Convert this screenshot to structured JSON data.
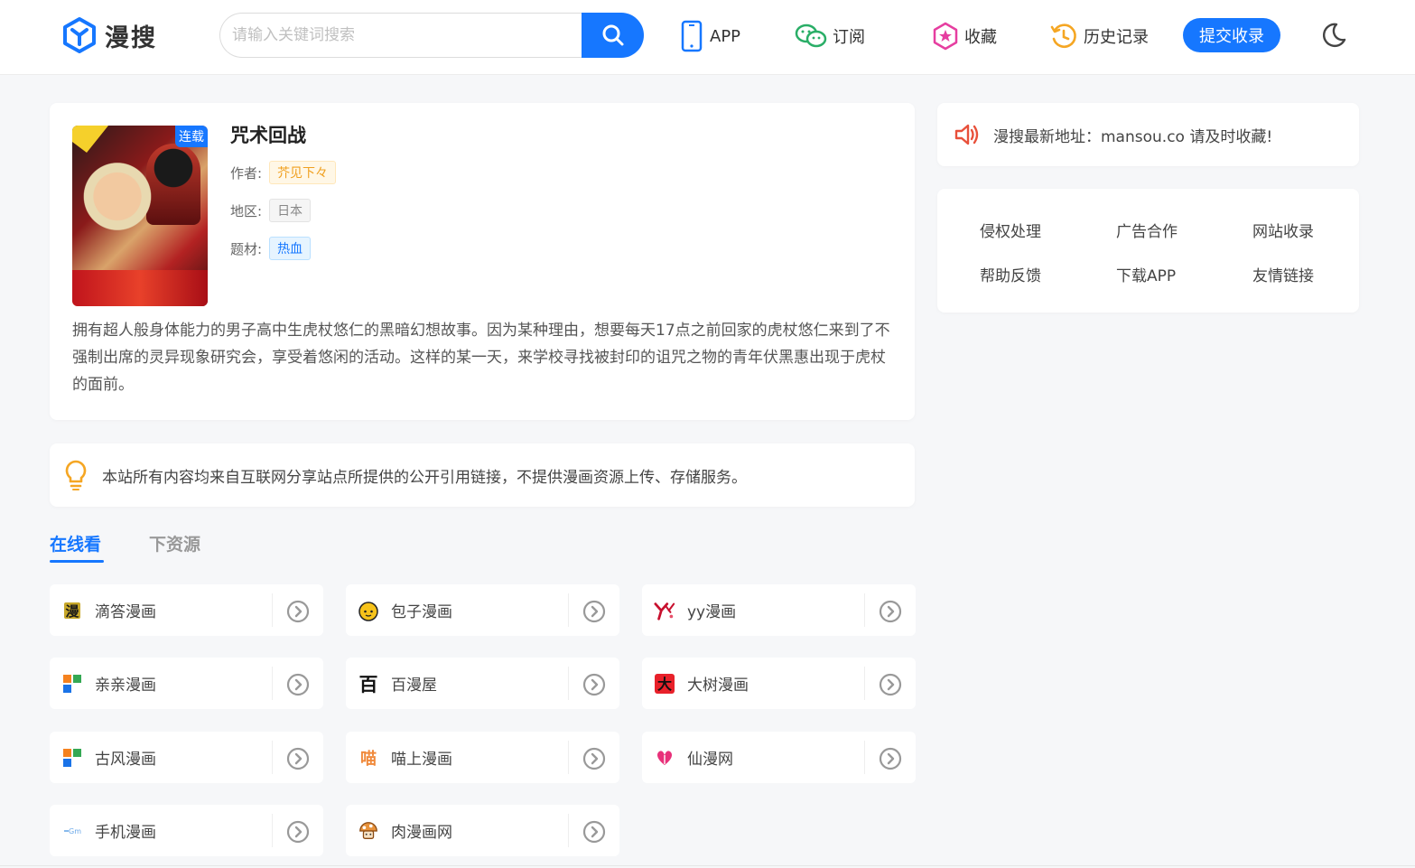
{
  "header": {
    "logo_text": "漫搜",
    "search_placeholder": "请输入关键词搜索",
    "nav": {
      "app": "APP",
      "subscribe": "订阅",
      "favorites": "收藏",
      "history": "历史记录"
    },
    "submit_label": "提交收录",
    "brand_color": "#1677ff"
  },
  "comic": {
    "badge": "连载",
    "title": "咒术回战",
    "author_label": "作者:",
    "author": "芥见下々",
    "region_label": "地区:",
    "region": "日本",
    "genre_label": "题材:",
    "genre": "热血",
    "description": "拥有超人般身体能力的男子高中生虎杖悠仁的黑暗幻想故事。因为某种理由，想要每天17点之前回家的虎杖悠仁来到了不强制出席的灵异现象研究会，享受着悠闲的活动。这样的某一天，来学校寻找被封印的诅咒之物的青年伏黑惠出现于虎杖的面前。"
  },
  "notice": "本站所有内容均来自互联网分享站点所提供的公开引用链接，不提供漫画资源上传、存储服务。",
  "sidebar": {
    "announcement": "漫搜最新地址：mansou.co 请及时收藏!",
    "links": [
      "侵权处理",
      "广告合作",
      "网站收录",
      "帮助反馈",
      "下载APP",
      "友情链接"
    ]
  },
  "tabs": [
    "在线看",
    "下资源"
  ],
  "sources": [
    {
      "name": "滴答漫画",
      "icon": "dida-icon"
    },
    {
      "name": "包子漫画",
      "icon": "baozi-icon"
    },
    {
      "name": "yy漫画",
      "icon": "yy-icon"
    },
    {
      "name": "亲亲漫画",
      "icon": "qinqin-icon"
    },
    {
      "name": "百漫屋",
      "icon": "baiman-icon"
    },
    {
      "name": "大树漫画",
      "icon": "dashu-icon"
    },
    {
      "name": "古风漫画",
      "icon": "gufeng-icon"
    },
    {
      "name": "喵上漫画",
      "icon": "miao-icon"
    },
    {
      "name": "仙漫网",
      "icon": "xian-icon"
    },
    {
      "name": "手机漫画",
      "icon": "shouji-icon"
    },
    {
      "name": "肉漫画网",
      "icon": "rou-icon"
    }
  ]
}
